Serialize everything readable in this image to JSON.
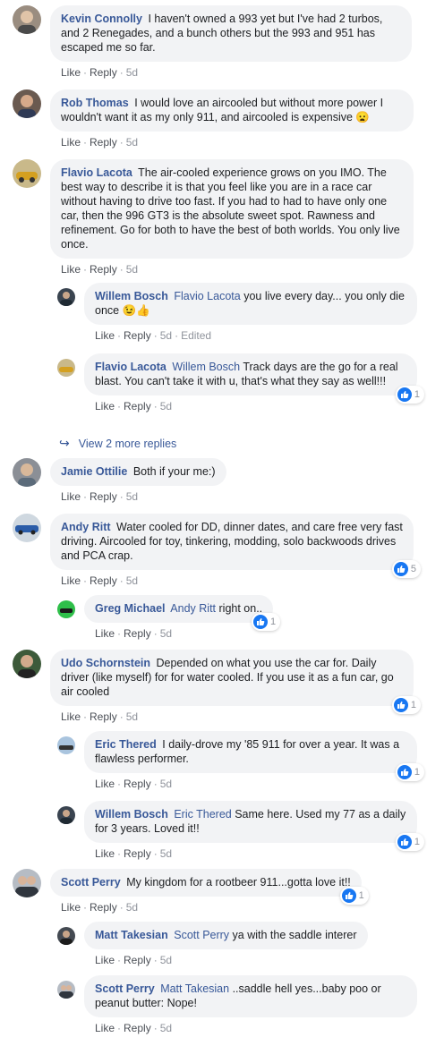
{
  "labels": {
    "like": "Like",
    "reply": "Reply",
    "edited": "Edited"
  },
  "comments": [
    {
      "author": "Kevin Connolly",
      "mention": "",
      "text": "I haven't owned a 993 yet but I've had 2 turbos, and 2 Renegades, and a bunch others but the 993 and 951 has escaped me so far.",
      "time": "5d"
    },
    {
      "author": "Rob Thomas",
      "mention": "",
      "text": "I would love an aircooled but without more power I wouldn't want it as my only 911, and aircooled is expensive 😦",
      "time": "5d"
    },
    {
      "author": "Flavio Lacota",
      "mention": "",
      "text": "The air-cooled experience grows on you IMO. The best way to describe it is that you feel like you are in a race car without having to drive too fast. If you had to had to have only one car, then the 996 GT3 is the absolute sweet spot. Rawness and refinement. Go for both to have the best of both worlds. You only live once.",
      "time": "5d"
    },
    {
      "author": "Willem Bosch",
      "mention": "Flavio Lacota",
      "text": "you live every day... you only die once 😉👍",
      "time": "5d"
    },
    {
      "author": "Flavio Lacota",
      "mention": "Willem Bosch",
      "text": "Track days are the go for a real blast. You can't take it with u, that's what they say as well!!!",
      "time": "5d",
      "reactions": "1"
    },
    {
      "author": "Jamie Ottilie",
      "mention": "",
      "text": "Both if your me:)",
      "time": "5d"
    },
    {
      "author": "Andy Ritt",
      "mention": "",
      "text": "Water cooled for DD, dinner dates, and care free very fast driving. Aircooled for toy, tinkering, modding, solo backwoods drives and PCA crap.",
      "time": "5d",
      "reactions": "5"
    },
    {
      "author": "Greg Michael",
      "mention": "Andy Ritt",
      "text": "right on..",
      "time": "5d",
      "reactions": "1"
    },
    {
      "author": "Udo Schornstein",
      "mention": "",
      "text": "Depended on what you use the car for. Daily driver (like myself) for for water cooled. If you use it as a fun car, go air cooled",
      "time": "5d",
      "reactions": "1"
    },
    {
      "author": "Eric Thered",
      "mention": "",
      "text": "I daily-drove my '85 911 for over a year. It was a flawless performer.",
      "time": "5d",
      "reactions": "1"
    },
    {
      "author": "Willem Bosch",
      "mention": "Eric Thered",
      "text": "Same here. Used my 77 as a daily for 3 years. Loved it!!",
      "time": "5d",
      "reactions": "1"
    },
    {
      "author": "Scott Perry",
      "mention": "",
      "text": "My kingdom for a rootbeer 911...gotta love it!!",
      "time": "5d",
      "reactions": "1"
    },
    {
      "author": "Matt Takesian",
      "mention": "Scott Perry",
      "text": "ya with the saddle interer",
      "time": "5d"
    },
    {
      "author": "Scott Perry",
      "mention": "Matt Takesian",
      "text": "..saddle hell yes...baby poo or peanut butter: Nope!",
      "time": "5d"
    }
  ],
  "view_more_replies": "View 2 more replies",
  "colors": {
    "link": "#385898",
    "bubble": "#f2f3f5",
    "meta": "#90949c",
    "like_blue": "#1877f2"
  }
}
